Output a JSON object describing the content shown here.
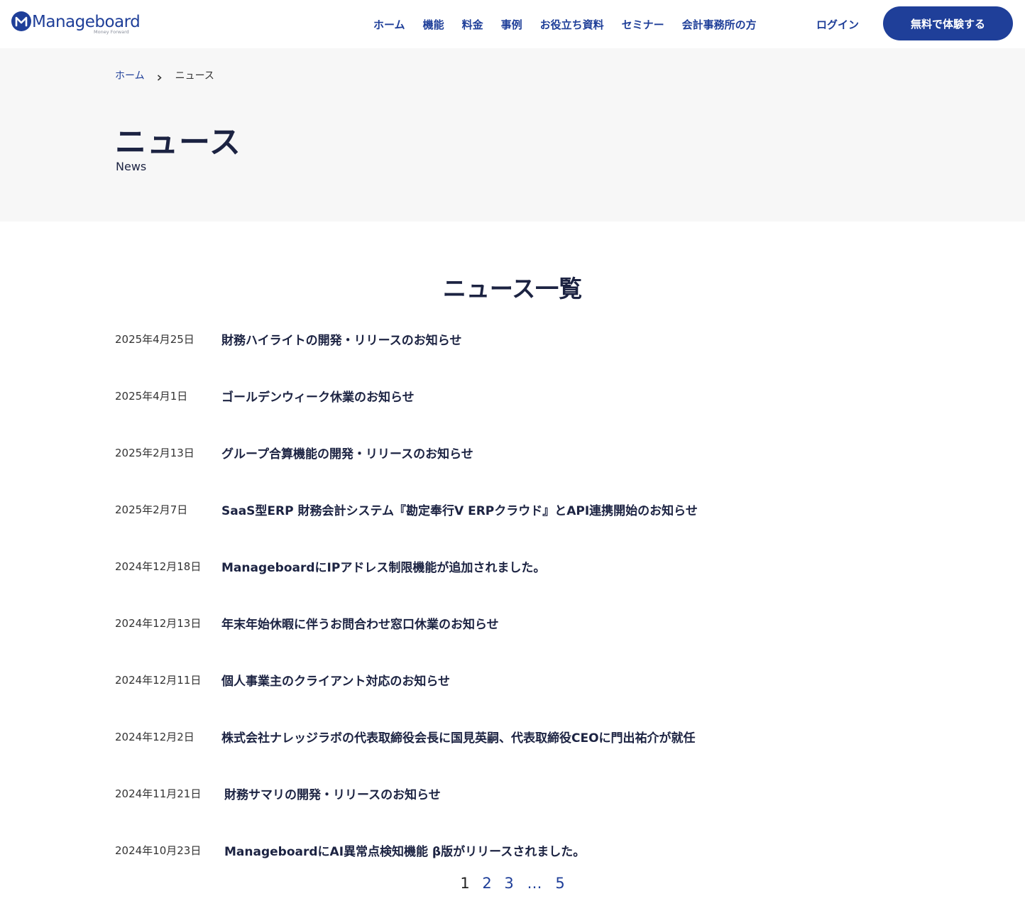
{
  "header": {
    "logo": {
      "wordmark": "Manageboard",
      "tagline": "Money Forward"
    },
    "nav": [
      {
        "label": "ホーム"
      },
      {
        "label": "機能"
      },
      {
        "label": "料金"
      },
      {
        "label": "事例"
      },
      {
        "label": "お役立ち資料"
      },
      {
        "label": "セミナー"
      },
      {
        "label": "会計事務所の方"
      }
    ],
    "login_label": "ログイン",
    "cta_label": "無料で体験する"
  },
  "breadcrumb": {
    "home": "ホーム",
    "current": "ニュース"
  },
  "hero": {
    "title": "ニュース",
    "subtitle": "News"
  },
  "section_title": "ニュース一覧",
  "news": [
    {
      "date": "2025年4月25日",
      "title": "財務ハイライトの開発・リリースのお知らせ"
    },
    {
      "date": "2025年4月1日",
      "title": "ゴールデンウィーク休業のお知らせ"
    },
    {
      "date": "2025年2月13日",
      "title": "グループ合算機能の開発・リリースのお知らせ"
    },
    {
      "date": "2025年2月7日",
      "title": "SaaS型ERP 財務会計システム『勘定奉行V ERPクラウド』とAPI連携開始のお知らせ"
    },
    {
      "date": "2024年12月18日",
      "title": "ManageboardにIPアドレス制限機能が追加されました。"
    },
    {
      "date": "2024年12月13日",
      "title": "年末年始休暇に伴うお問合わせ窓口休業のお知らせ"
    },
    {
      "date": "2024年12月11日",
      "title": "個人事業主のクライアント対応のお知らせ"
    },
    {
      "date": "2024年12月2日",
      "title": "株式会社ナレッジラボの代表取締役会長に国見英嗣、代表取締役CEOに門出祐介が就任"
    },
    {
      "date": "2024年11月21日",
      "title": "財務サマリの開発・リリースのお知らせ"
    },
    {
      "date": "2024年10月23日",
      "title": "ManageboardにAI異常点検知機能 β版がリリースされました。"
    }
  ],
  "pagination": {
    "pages": [
      "1",
      "2",
      "3"
    ],
    "ellipsis": "…",
    "last": "5",
    "current": "1"
  },
  "colors": {
    "brand": "#1f3f99",
    "text": "#1c2342",
    "hero_bg": "#f7f7f7"
  }
}
